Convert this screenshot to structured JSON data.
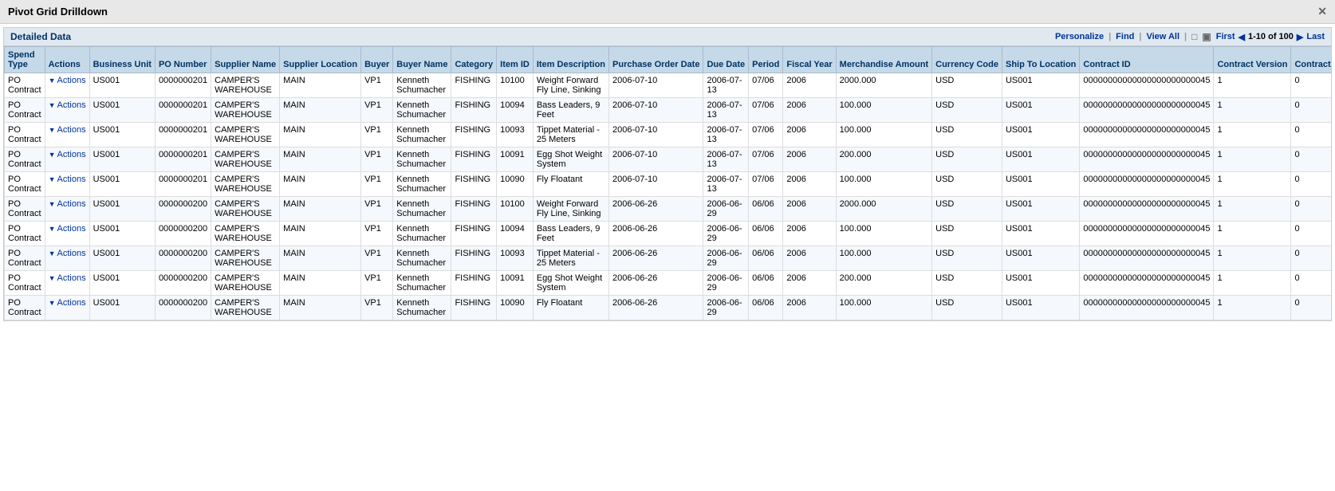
{
  "title": "Pivot Grid Drilldown",
  "panel": {
    "header": "Detailed Data",
    "personalize": "Personalize",
    "find": "Find",
    "viewAll": "View All",
    "pagination": {
      "first": "First",
      "last": "Last",
      "range": "1-10 of 100"
    }
  },
  "columns": [
    {
      "key": "spend_type",
      "label": "Spend Type"
    },
    {
      "key": "actions",
      "label": "Actions"
    },
    {
      "key": "business_unit",
      "label": "Business Unit"
    },
    {
      "key": "po_number",
      "label": "PO Number"
    },
    {
      "key": "supplier_name",
      "label": "Supplier Name"
    },
    {
      "key": "supplier_location",
      "label": "Supplier Location"
    },
    {
      "key": "buyer",
      "label": "Buyer"
    },
    {
      "key": "buyer_name",
      "label": "Buyer Name"
    },
    {
      "key": "category",
      "label": "Category"
    },
    {
      "key": "item_id",
      "label": "Item ID"
    },
    {
      "key": "item_description",
      "label": "Item Description"
    },
    {
      "key": "purchase_order_date",
      "label": "Purchase Order Date"
    },
    {
      "key": "due_date",
      "label": "Due Date"
    },
    {
      "key": "period",
      "label": "Period"
    },
    {
      "key": "fiscal_year",
      "label": "Fiscal Year"
    },
    {
      "key": "merchandise_amount",
      "label": "Merchandise Amount"
    },
    {
      "key": "currency_code",
      "label": "Currency Code"
    },
    {
      "key": "ship_to_location",
      "label": "Ship To Location"
    },
    {
      "key": "contract_id",
      "label": "Contract ID"
    },
    {
      "key": "contract_version",
      "label": "Contract Version"
    },
    {
      "key": "contract_line_nbr",
      "label": "Contract Line Nbr"
    }
  ],
  "rows": [
    {
      "spend_type": "PO Contract",
      "actions": "Actions",
      "business_unit": "US001",
      "po_number": "0000000201",
      "supplier_name": "CAMPER'S WAREHOUSE",
      "supplier_location": "MAIN",
      "buyer": "VP1",
      "buyer_name": "Kenneth Schumacher",
      "category": "FISHING",
      "item_id": "10100",
      "item_description": "Weight Forward Fly Line, Sinking",
      "purchase_order_date": "2006-07-10",
      "due_date": "2006-07-13",
      "period": "07/06",
      "fiscal_year": "2006",
      "merchandise_amount": "2000.000",
      "currency_code": "USD",
      "ship_to_location": "US001",
      "contract_id": "00000000000000000000000045",
      "contract_version": "1",
      "contract_line_nbr": "0"
    },
    {
      "spend_type": "PO Contract",
      "actions": "Actions",
      "business_unit": "US001",
      "po_number": "0000000201",
      "supplier_name": "CAMPER'S WAREHOUSE",
      "supplier_location": "MAIN",
      "buyer": "VP1",
      "buyer_name": "Kenneth Schumacher",
      "category": "FISHING",
      "item_id": "10094",
      "item_description": "Bass Leaders, 9 Feet",
      "purchase_order_date": "2006-07-10",
      "due_date": "2006-07-13",
      "period": "07/06",
      "fiscal_year": "2006",
      "merchandise_amount": "100.000",
      "currency_code": "USD",
      "ship_to_location": "US001",
      "contract_id": "00000000000000000000000045",
      "contract_version": "1",
      "contract_line_nbr": "0"
    },
    {
      "spend_type": "PO Contract",
      "actions": "Actions",
      "business_unit": "US001",
      "po_number": "0000000201",
      "supplier_name": "CAMPER'S WAREHOUSE",
      "supplier_location": "MAIN",
      "buyer": "VP1",
      "buyer_name": "Kenneth Schumacher",
      "category": "FISHING",
      "item_id": "10093",
      "item_description": "Tippet Material - 25 Meters",
      "purchase_order_date": "2006-07-10",
      "due_date": "2006-07-13",
      "period": "07/06",
      "fiscal_year": "2006",
      "merchandise_amount": "100.000",
      "currency_code": "USD",
      "ship_to_location": "US001",
      "contract_id": "00000000000000000000000045",
      "contract_version": "1",
      "contract_line_nbr": "0"
    },
    {
      "spend_type": "PO Contract",
      "actions": "Actions",
      "business_unit": "US001",
      "po_number": "0000000201",
      "supplier_name": "CAMPER'S WAREHOUSE",
      "supplier_location": "MAIN",
      "buyer": "VP1",
      "buyer_name": "Kenneth Schumacher",
      "category": "FISHING",
      "item_id": "10091",
      "item_description": "Egg Shot Weight System",
      "purchase_order_date": "2006-07-10",
      "due_date": "2006-07-13",
      "period": "07/06",
      "fiscal_year": "2006",
      "merchandise_amount": "200.000",
      "currency_code": "USD",
      "ship_to_location": "US001",
      "contract_id": "00000000000000000000000045",
      "contract_version": "1",
      "contract_line_nbr": "0"
    },
    {
      "spend_type": "PO Contract",
      "actions": "Actions",
      "business_unit": "US001",
      "po_number": "0000000201",
      "supplier_name": "CAMPER'S WAREHOUSE",
      "supplier_location": "MAIN",
      "buyer": "VP1",
      "buyer_name": "Kenneth Schumacher",
      "category": "FISHING",
      "item_id": "10090",
      "item_description": "Fly Floatant",
      "purchase_order_date": "2006-07-10",
      "due_date": "2006-07-13",
      "period": "07/06",
      "fiscal_year": "2006",
      "merchandise_amount": "100.000",
      "currency_code": "USD",
      "ship_to_location": "US001",
      "contract_id": "00000000000000000000000045",
      "contract_version": "1",
      "contract_line_nbr": "0"
    },
    {
      "spend_type": "PO Contract",
      "actions": "Actions",
      "business_unit": "US001",
      "po_number": "0000000200",
      "supplier_name": "CAMPER'S WAREHOUSE",
      "supplier_location": "MAIN",
      "buyer": "VP1",
      "buyer_name": "Kenneth Schumacher",
      "category": "FISHING",
      "item_id": "10100",
      "item_description": "Weight Forward Fly Line, Sinking",
      "purchase_order_date": "2006-06-26",
      "due_date": "2006-06-29",
      "period": "06/06",
      "fiscal_year": "2006",
      "merchandise_amount": "2000.000",
      "currency_code": "USD",
      "ship_to_location": "US001",
      "contract_id": "00000000000000000000000045",
      "contract_version": "1",
      "contract_line_nbr": "0"
    },
    {
      "spend_type": "PO Contract",
      "actions": "Actions",
      "business_unit": "US001",
      "po_number": "0000000200",
      "supplier_name": "CAMPER'S WAREHOUSE",
      "supplier_location": "MAIN",
      "buyer": "VP1",
      "buyer_name": "Kenneth Schumacher",
      "category": "FISHING",
      "item_id": "10094",
      "item_description": "Bass Leaders, 9 Feet",
      "purchase_order_date": "2006-06-26",
      "due_date": "2006-06-29",
      "period": "06/06",
      "fiscal_year": "2006",
      "merchandise_amount": "100.000",
      "currency_code": "USD",
      "ship_to_location": "US001",
      "contract_id": "00000000000000000000000045",
      "contract_version": "1",
      "contract_line_nbr": "0"
    },
    {
      "spend_type": "PO Contract",
      "actions": "Actions",
      "business_unit": "US001",
      "po_number": "0000000200",
      "supplier_name": "CAMPER'S WAREHOUSE",
      "supplier_location": "MAIN",
      "buyer": "VP1",
      "buyer_name": "Kenneth Schumacher",
      "category": "FISHING",
      "item_id": "10093",
      "item_description": "Tippet Material - 25 Meters",
      "purchase_order_date": "2006-06-26",
      "due_date": "2006-06-29",
      "period": "06/06",
      "fiscal_year": "2006",
      "merchandise_amount": "100.000",
      "currency_code": "USD",
      "ship_to_location": "US001",
      "contract_id": "00000000000000000000000045",
      "contract_version": "1",
      "contract_line_nbr": "0"
    },
    {
      "spend_type": "PO Contract",
      "actions": "Actions",
      "business_unit": "US001",
      "po_number": "0000000200",
      "supplier_name": "CAMPER'S WAREHOUSE",
      "supplier_location": "MAIN",
      "buyer": "VP1",
      "buyer_name": "Kenneth Schumacher",
      "category": "FISHING",
      "item_id": "10091",
      "item_description": "Egg Shot Weight System",
      "purchase_order_date": "2006-06-26",
      "due_date": "2006-06-29",
      "period": "06/06",
      "fiscal_year": "2006",
      "merchandise_amount": "200.000",
      "currency_code": "USD",
      "ship_to_location": "US001",
      "contract_id": "00000000000000000000000045",
      "contract_version": "1",
      "contract_line_nbr": "0"
    },
    {
      "spend_type": "PO Contract",
      "actions": "Actions",
      "business_unit": "US001",
      "po_number": "0000000200",
      "supplier_name": "CAMPER'S WAREHOUSE",
      "supplier_location": "MAIN",
      "buyer": "VP1",
      "buyer_name": "Kenneth Schumacher",
      "category": "FISHING",
      "item_id": "10090",
      "item_description": "Fly Floatant",
      "purchase_order_date": "2006-06-26",
      "due_date": "2006-06-29",
      "period": "06/06",
      "fiscal_year": "2006",
      "merchandise_amount": "100.000",
      "currency_code": "USD",
      "ship_to_location": "US001",
      "contract_id": "00000000000000000000000045",
      "contract_version": "1",
      "contract_line_nbr": "0"
    }
  ]
}
